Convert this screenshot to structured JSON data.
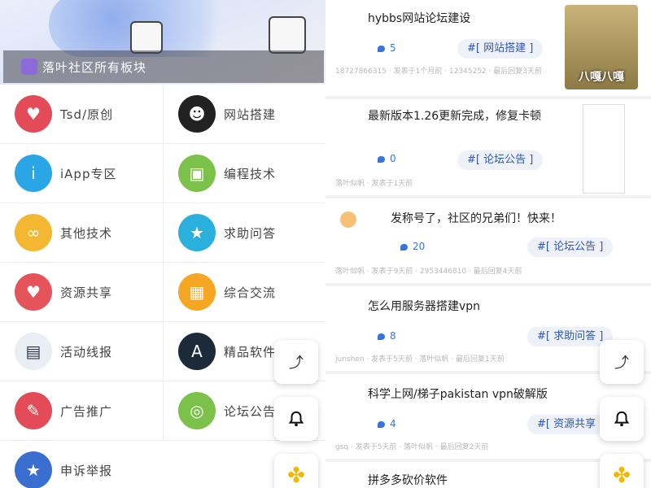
{
  "left": {
    "banner_title": "落叶社区所有板块",
    "boards": [
      {
        "label": "Tsd/原创",
        "icon": "heart-timer-icon",
        "color": "#e24b57",
        "glyph": "♥"
      },
      {
        "label": "网站搭建",
        "icon": "panda-meme-icon",
        "color": "#222222",
        "glyph": "☻"
      },
      {
        "label": "iApp专区",
        "icon": "info-icon",
        "color": "#2aa5e6",
        "glyph": "i"
      },
      {
        "label": "编程技术",
        "icon": "android-icon",
        "color": "#7cc24a",
        "glyph": "▣"
      },
      {
        "label": "其他技术",
        "icon": "glasses-icon",
        "color": "#f4b731",
        "glyph": "∞"
      },
      {
        "label": "求助问答",
        "icon": "medal-icon",
        "color": "#2ab0dd",
        "glyph": "★"
      },
      {
        "label": "资源共享",
        "icon": "timer-icon",
        "color": "#e5545b",
        "glyph": "♥"
      },
      {
        "label": "综合交流",
        "icon": "bus-icon",
        "color": "#f5a623",
        "glyph": "▦"
      },
      {
        "label": "活动线报",
        "icon": "newspaper-icon",
        "color": "#e9eef4",
        "glyph": "▤"
      },
      {
        "label": "精品软件",
        "icon": "app-store-icon",
        "color": "#1d2a3a",
        "glyph": "A"
      },
      {
        "label": "广告推广",
        "icon": "notepad-icon",
        "color": "#e24b57",
        "glyph": "✎"
      },
      {
        "label": "论坛公告",
        "icon": "lollipop-icon",
        "color": "#7cc24a",
        "glyph": "◎"
      },
      {
        "label": "申诉举报",
        "icon": "shield-icon",
        "color": "#3a6fd0",
        "glyph": "★"
      }
    ]
  },
  "fabs": {
    "up": "⤴",
    "bell": "bell-icon",
    "clover": "clover-icon"
  },
  "right": {
    "posts": [
      {
        "title": "hybbs网站论坛建设",
        "count": "5",
        "tag": "#[ 网站搭建 ]",
        "meta": "18727866315 · 发表于1个月前 · 12345252 · 最后回复3天前",
        "thumb": "soldier-meme",
        "thumb_text": "八嘎八嘎"
      },
      {
        "title": "最新版本1.26更新完成，修复卡顿",
        "count": "0",
        "tag": "#[ 论坛公告 ]",
        "meta": "落叶似帆 · 发表于1天前",
        "thumb": "phone-screenshot"
      },
      {
        "title": "发称号了，社区的兄弟们！快来！",
        "count": "20",
        "tag": "#[ 论坛公告 ]",
        "meta": "落叶似帆 · 发表于9天前 · 2953446810 · 最后回复4天前"
      },
      {
        "title": "怎么用服务器搭建vpn",
        "count": "8",
        "tag": "#[ 求助问答 ]",
        "meta": "junshen · 发表于5天前 · 落叶似帆 · 最后回复1天前"
      },
      {
        "title": "科学上网/梯子pakistan vpn破解版",
        "count": "4",
        "tag": "#[ 资源共享 ]",
        "meta": "gsq · 发表于5天前 · 落叶似帆 · 最后回复2天前"
      },
      {
        "title": "拼多多砍价软件",
        "count": "",
        "tag": "",
        "meta": ""
      }
    ]
  }
}
